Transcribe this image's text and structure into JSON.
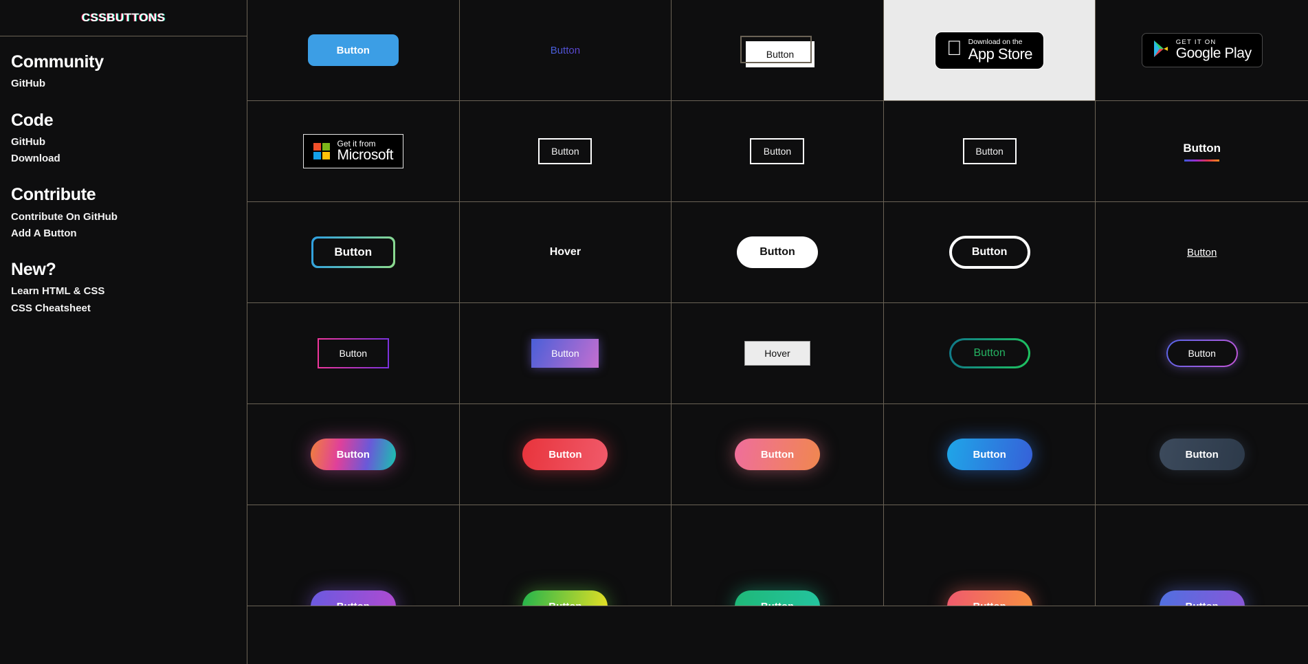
{
  "sidebar": {
    "logo": "CSSBUTTONS",
    "groups": [
      {
        "title": "Community",
        "links": [
          "GitHub"
        ]
      },
      {
        "title": "Code",
        "links": [
          "GitHub",
          "Download"
        ]
      },
      {
        "title": "Contribute",
        "links": [
          "Contribute On GitHub",
          "Add A Button"
        ]
      },
      {
        "title": "New?",
        "links": [
          "Learn HTML & CSS",
          "CSS Cheatsheet"
        ]
      }
    ]
  },
  "colors": {
    "page_bg": "#0e0e0f",
    "grid_line": "#6b6356",
    "text": "#ffffff",
    "accent_blue": "#3c9ee5",
    "light_cell_bg": "#eaeaea"
  },
  "buttons": {
    "r1": {
      "c1": {
        "label": "Button",
        "style": "solid-blue-rounded"
      },
      "c2": {
        "label": "Button",
        "style": "gradient-text"
      },
      "c3": {
        "label": "Button",
        "style": "white-offset-outline"
      },
      "c4": {
        "line1": "Download on the",
        "line2": "App Store",
        "style": "app-store-badge"
      },
      "c5": {
        "line1": "GET IT ON",
        "line2": "Google Play",
        "style": "google-play-badge"
      }
    },
    "r2": {
      "c1": {
        "line1": "Get it from",
        "line2": "Microsoft",
        "style": "microsoft-badge"
      },
      "c2": {
        "label": "Button",
        "style": "white-outline"
      },
      "c3": {
        "label": "Button",
        "style": "white-outline"
      },
      "c4": {
        "label": "Button",
        "style": "white-outline"
      },
      "c5": {
        "label": "Button",
        "style": "gradient-underline"
      }
    },
    "r3": {
      "c1": {
        "label": "Button",
        "style": "gradient-border-blue-green"
      },
      "c2": {
        "label": "Hover",
        "style": "text-only"
      },
      "c3": {
        "label": "Button",
        "style": "white-pill"
      },
      "c4": {
        "label": "Button",
        "style": "white-outlined-pill"
      },
      "c5": {
        "label": "Button",
        "style": "underlined-link"
      }
    },
    "r4": {
      "c1": {
        "label": "Button",
        "style": "pink-purple-border"
      },
      "c2": {
        "label": "Button",
        "style": "blue-pink-gradient-fill"
      },
      "c3": {
        "label": "Hover",
        "style": "classic-light"
      },
      "c4": {
        "label": "Button",
        "style": "green-outlined-pill"
      },
      "c5": {
        "label": "Button",
        "style": "glowing-purple-pill"
      }
    },
    "r5": {
      "c1": {
        "label": "Button",
        "style": "rainbow-glow-pill"
      },
      "c2": {
        "label": "Button",
        "style": "red-glow-pill"
      },
      "c3": {
        "label": "Button",
        "style": "pink-orange-glow-pill"
      },
      "c4": {
        "label": "Button",
        "style": "blue-glow-pill"
      },
      "c5": {
        "label": "Button",
        "style": "slate-pill"
      }
    },
    "r6": {
      "c1": {
        "label": "Button",
        "style": "violet-glow-pill"
      },
      "c2": {
        "label": "Button",
        "style": "green-yellow-glow-pill"
      },
      "c3": {
        "label": "Button",
        "style": "teal-glow-pill"
      },
      "c4": {
        "label": "Button",
        "style": "coral-glow-pill"
      },
      "c5": {
        "label": "Button",
        "style": "indigo-glow-pill"
      }
    }
  }
}
